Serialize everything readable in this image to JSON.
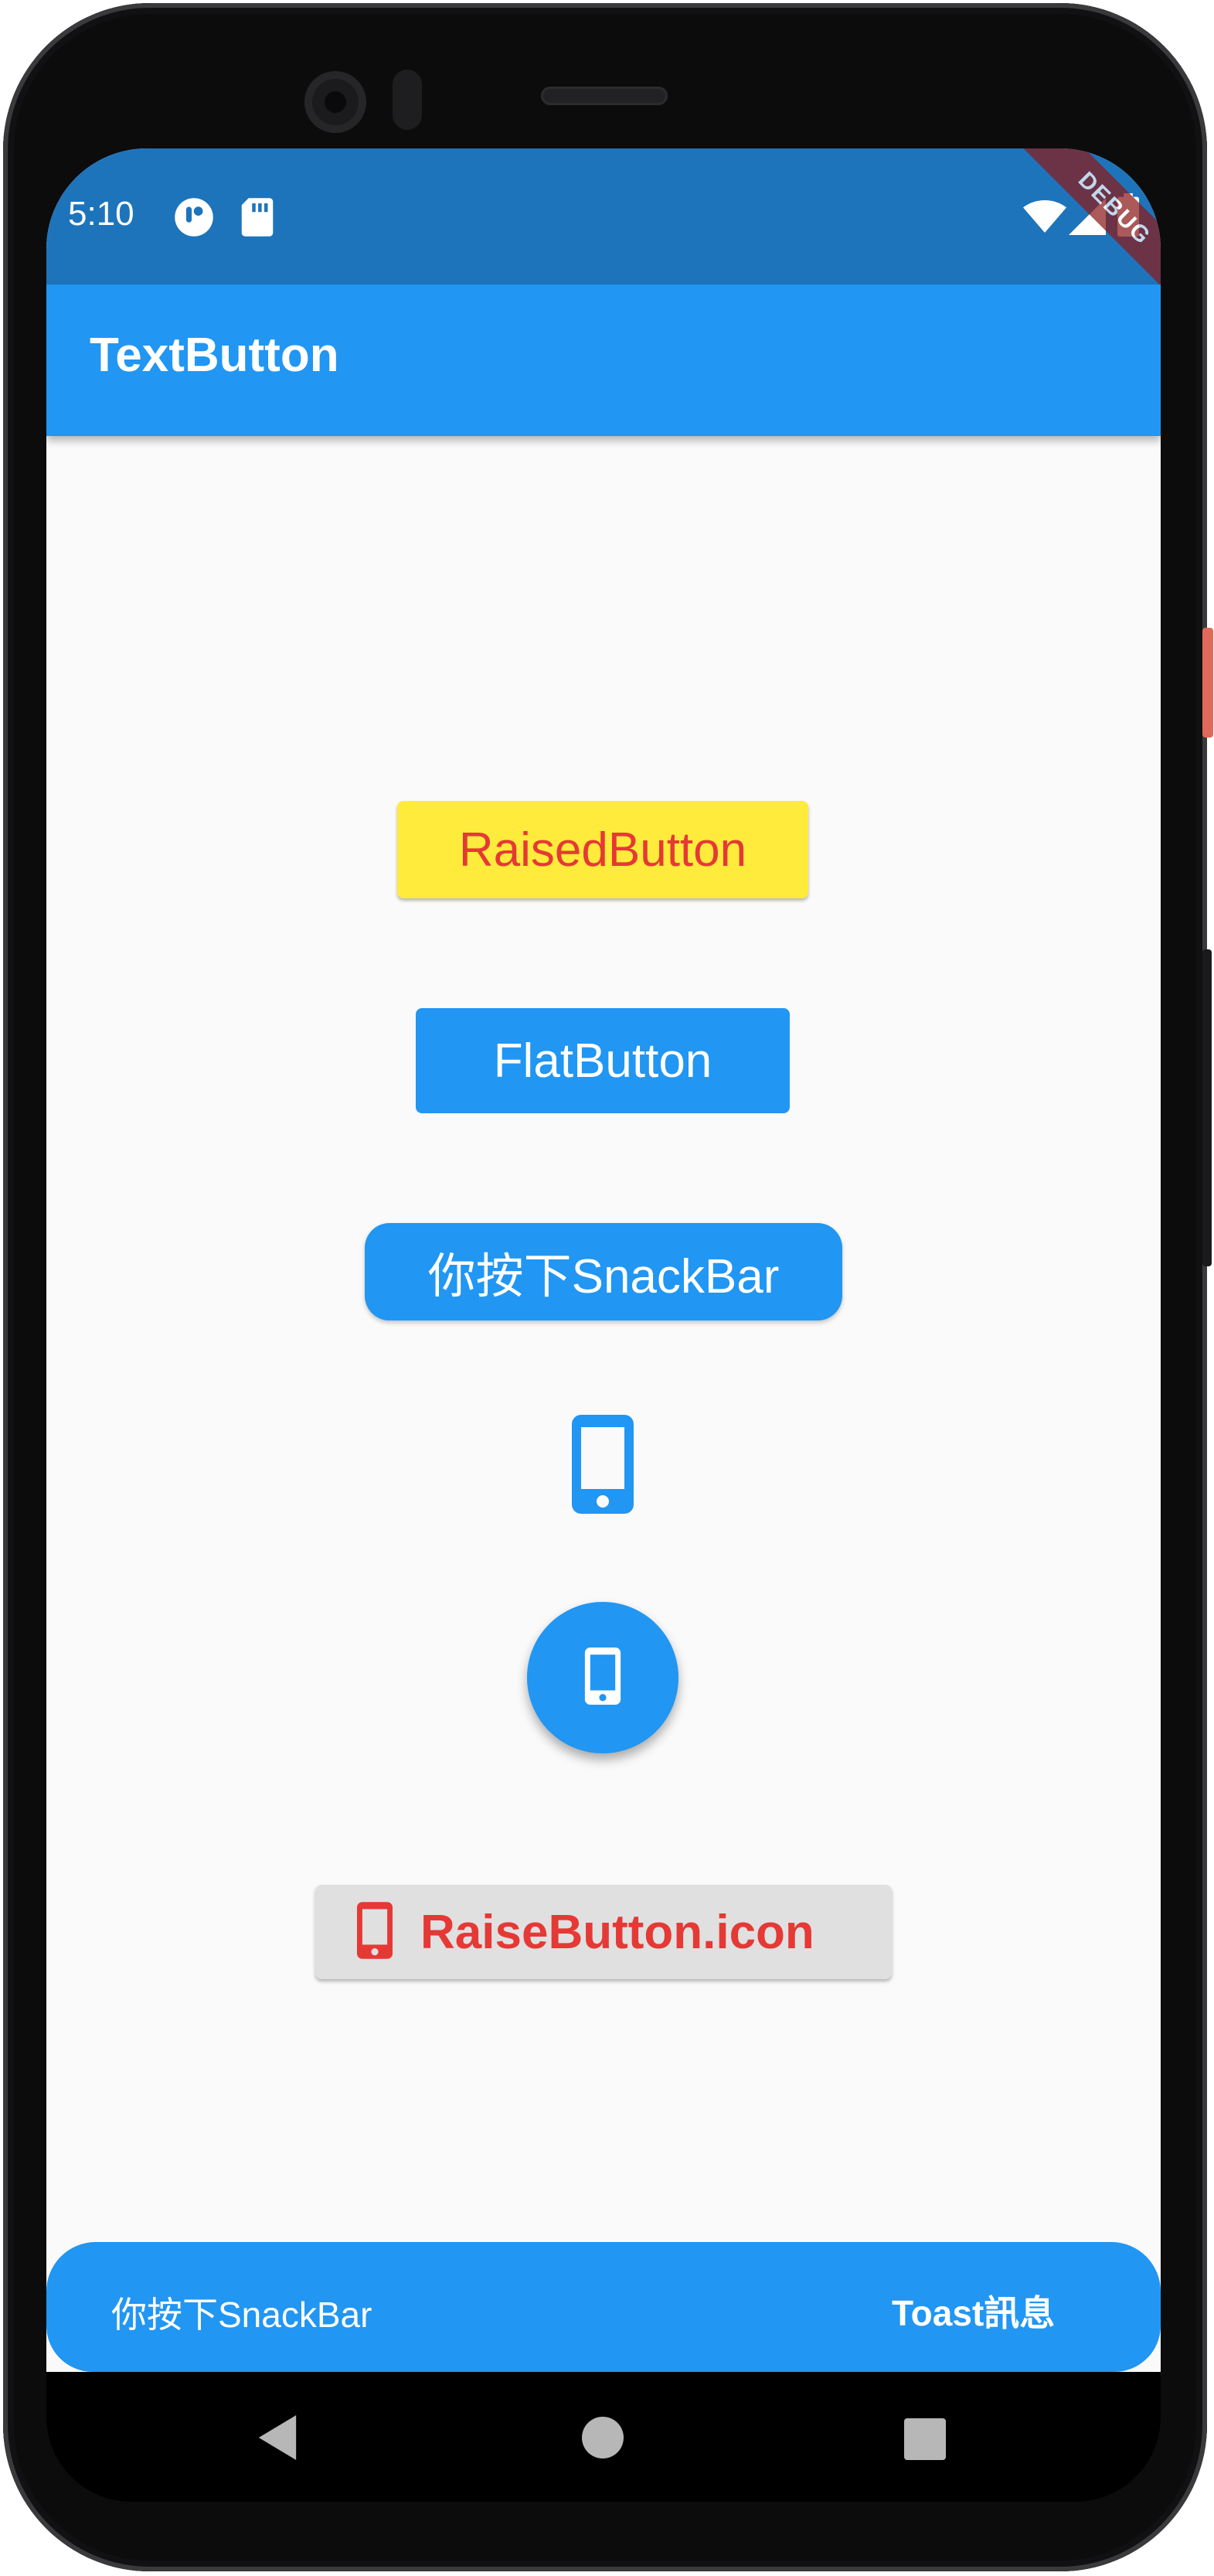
{
  "status_bar": {
    "time": "5:10",
    "debug_banner": "DEBUG"
  },
  "app_bar": {
    "title": "TextButton"
  },
  "buttons": {
    "raised_button_label": "RaisedButton",
    "flat_button_label": "FlatButton",
    "snackbar_button_label": "你按下SnackBar",
    "icon_button_icon": "phone-android-icon",
    "fab_icon": "phone-android-icon",
    "raise_button_icon_label": "RaiseButton.icon"
  },
  "snackbar": {
    "message": "你按下SnackBar",
    "action_label": "Toast訊息"
  },
  "colors": {
    "primary": "#2196f3",
    "status_bar": "#1e74bb",
    "raised_button_bg": "#ffeb3b",
    "red_text": "#e53935",
    "grey_button_bg": "#e0e0e0"
  }
}
